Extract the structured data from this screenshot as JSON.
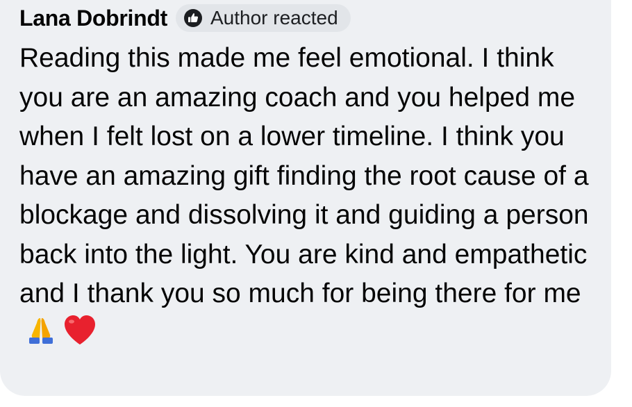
{
  "comment": {
    "author_name": "Lana Dobrindt",
    "badge": {
      "icon": "thumbs-up-icon",
      "label": "Author reacted"
    },
    "text": "Reading this made me feel emotional. I think you are an amazing coach and you helped me when I felt lost on a lower timeline. I think you have an amazing gift finding the root cause of a blockage and dissolving it and guiding a person back into the light. You are kind and empathetic and I thank you so much for being there for me",
    "emojis": [
      "folded-hands-emoji",
      "red-heart-emoji"
    ]
  },
  "colors": {
    "bubble_background": "#eef0f3",
    "badge_background": "#e2e5e9",
    "text": "#050505",
    "heart": "#e8212e",
    "hands": "#f7b500",
    "sleeve": "#3f6fd8"
  }
}
